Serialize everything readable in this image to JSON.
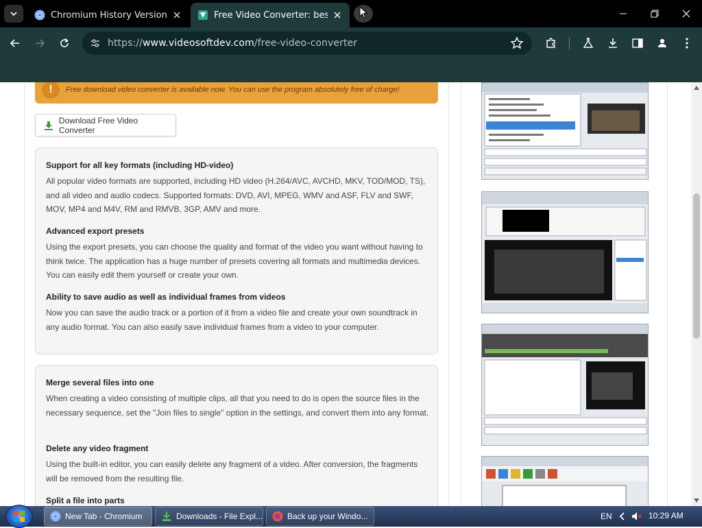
{
  "browser": {
    "tabs": [
      {
        "title": "Chromium History Versions Do",
        "active": false,
        "icon": "chromium-icon"
      },
      {
        "title": "Free Video Converter: best soft",
        "active": true,
        "icon": "videosoftdev-icon"
      }
    ],
    "url": {
      "scheme": "https://",
      "host": "www.videosoftdev.com",
      "path": "/free-video-converter"
    }
  },
  "page": {
    "notice": "Free download video converter is available now. You can use the program absolutely free of charge!",
    "download_button": "Download Free Video Converter",
    "box1": [
      {
        "title": "Support for all key formats (including HD-video)",
        "text": "All popular video formats are supported, including HD video (H.264/AVC, AVCHD, MKV, TOD/MOD, TS), and all video and audio codecs. Supported formats: DVD, AVI, MPEG, WMV and ASF, FLV and SWF, MOV, MP4 and M4V, RM and RMVB, 3GP, AMV and more."
      },
      {
        "title": "Advanced export presets",
        "text": "Using the export presets, you can choose the quality and format of the video you want without having to think twice. The application has a huge number of presets covering all formats and multimedia devices. You can easily edit them yourself or create your own."
      },
      {
        "title": "Ability to save audio as well as individual frames from videos",
        "text": "Now you can save the audio track or a portion of it from a video file and create your own soundtrack in any audio format. You can also easily save individual frames from a video to your computer."
      }
    ],
    "box2": [
      {
        "title": "Merge several files into one",
        "text": "When creating a video consisting of multiple clips, all that you need to do is open the source files in the necessary sequence, set the \"Join files to single\" option in the settings, and convert them into any format."
      },
      {
        "title": "Delete any video fragment",
        "text": "Using the built-in editor, you can easily delete any fragment of a video. After conversion, the fragments will be removed from the resulting file."
      },
      {
        "title": "Split a file into parts",
        "text": ""
      }
    ]
  },
  "taskbar": {
    "items": [
      {
        "label": "New Tab - Chromium",
        "icon": "chromium-icon",
        "active": true
      },
      {
        "label": "Downloads - File Expl...",
        "icon": "downloads-folder-icon",
        "active": false
      },
      {
        "label": "Back up your Windo...",
        "icon": "browser-icon",
        "active": false
      }
    ],
    "lang": "EN",
    "clock": "10:29 AM"
  },
  "colors": {
    "toolbar": "#1f3a3a",
    "notice_bg": "#e9a23b",
    "download_arrow": "#3a9a3a"
  }
}
